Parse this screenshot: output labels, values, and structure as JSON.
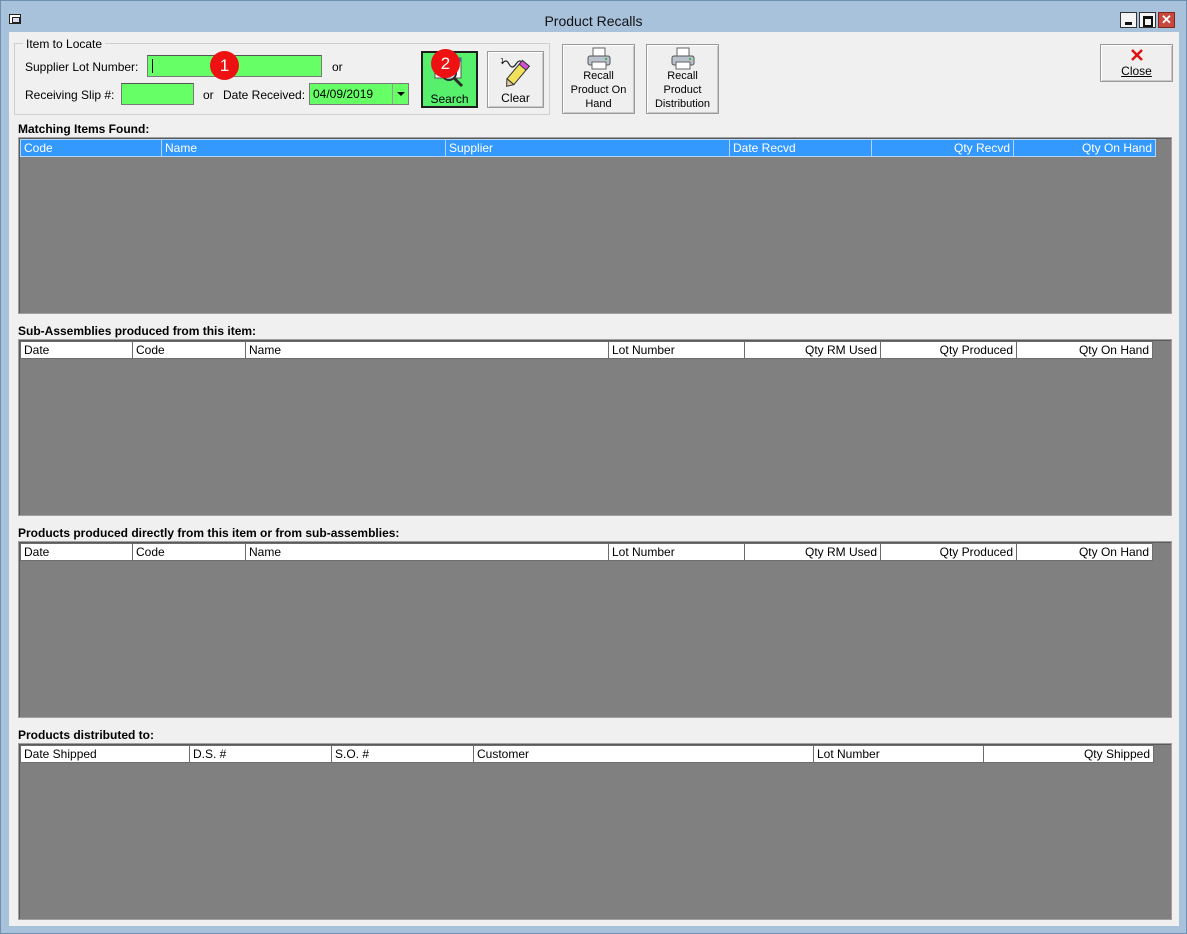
{
  "window": {
    "title": "Product Recalls"
  },
  "locate": {
    "legend": "Item to Locate",
    "lot_label": "Supplier Lot Number:",
    "lot_value": "",
    "or1": "or",
    "slip_label": "Receiving Slip #:",
    "slip_value": "",
    "or2": "or",
    "date_label": "Date Received:",
    "date_value": "04/09/2019"
  },
  "badges": {
    "one": "1",
    "two": "2"
  },
  "toolbar": {
    "search_label": "Search",
    "clear_label": "Clear",
    "recall_on_hand_lines": [
      "Recall",
      "Product On",
      "Hand"
    ],
    "recall_distribution_lines": [
      "Recall",
      "Product",
      "Distribution"
    ],
    "close_label": "Close"
  },
  "matching": {
    "title": "Matching Items Found:",
    "columns": [
      "Code",
      "Name",
      "Supplier",
      "Date Recvd",
      "Qty Recvd",
      "Qty On Hand"
    ],
    "rows": []
  },
  "subassemblies": {
    "title": "Sub-Assemblies produced from this item:",
    "columns": [
      "Date",
      "Code",
      "Name",
      "Lot Number",
      "Qty RM Used",
      "Qty Produced",
      "Qty On Hand"
    ],
    "rows": []
  },
  "products": {
    "title": "Products produced directly from this item or from sub-assemblies:",
    "columns": [
      "Date",
      "Code",
      "Name",
      "Lot Number",
      "Qty RM Used",
      "Qty Produced",
      "Qty On Hand"
    ],
    "rows": []
  },
  "distributed": {
    "title": "Products distributed to:",
    "columns": [
      "Date Shipped",
      "D.S. #",
      "S.O. #",
      "Customer",
      "Lot Number",
      "Qty Shipped"
    ],
    "rows": []
  },
  "colors": {
    "input_green": "#66ff66",
    "selected_header": "#3399ff",
    "grid_bg": "#808080",
    "badge_red": "#ee1111"
  },
  "icons": {
    "search": "magnifier-document-icon",
    "clear": "pencil-eraser-icon",
    "recall": "printer-icon",
    "close": "red-x-icon"
  }
}
